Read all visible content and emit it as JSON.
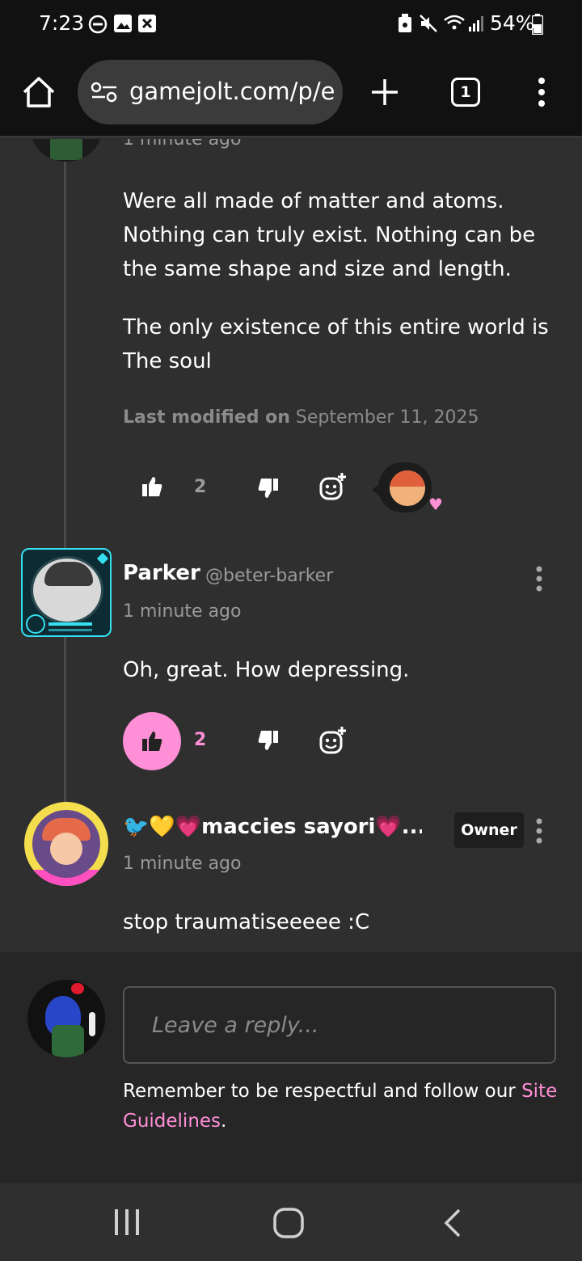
{
  "status_bar": {
    "time": "7:23",
    "battery": "54%"
  },
  "browser": {
    "url": "gamejolt.com/p/e",
    "tab_count": "1"
  },
  "thread": {
    "top_comment": {
      "time": "1 minute ago",
      "paragraph1": "Were all made of matter and atoms. Nothing can truly exist. Nothing can be the same shape and size and length.",
      "paragraph2": "The only existence of this entire world is The soul",
      "modified_label": "Last modified on",
      "modified_date": "September 11, 2025",
      "likes": "2"
    },
    "parker": {
      "name": "Parker",
      "handle": "@beter-barker",
      "time": "1 minute ago",
      "text": "Oh, great. How depressing.",
      "likes": "2"
    },
    "maccies": {
      "name": "🐦💛💗maccies sayori💗...",
      "badge": "Owner",
      "time": "1 minute ago",
      "text": "stop traumatiseeeee :C"
    }
  },
  "reply": {
    "placeholder": "Leave a reply...",
    "note_prefix": "Remember to be respectful and follow our",
    "link": "Site Guidelines",
    "note_suffix": "."
  },
  "colors": {
    "accent_pink": "#ff8fd6",
    "cyan_frame": "#36e0f0"
  }
}
